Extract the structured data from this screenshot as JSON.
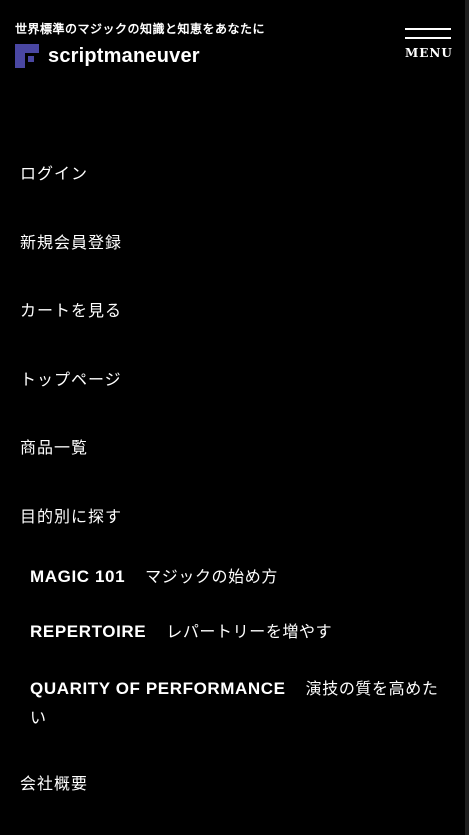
{
  "header": {
    "tagline": "世界標準のマジックの知識と知恵をあなたに",
    "logo_text": "scriptmaneuver",
    "logo_color": "#4a47a3",
    "menu_label": "MENU"
  },
  "nav": {
    "items": [
      {
        "label": "ログイン"
      },
      {
        "label": "新規会員登録"
      },
      {
        "label": "カートを見る"
      },
      {
        "label": "トップページ"
      },
      {
        "label": "商品一覧"
      },
      {
        "label": "目的別に探す"
      }
    ],
    "sub_items": [
      {
        "en": "MAGIC 101",
        "ja": "マジックの始め方"
      },
      {
        "en": "REPERTOIRE",
        "ja": "レパートリーを増やす"
      },
      {
        "en": "QUARITY OF PERFORMANCE",
        "ja": "演技の質を高めたい"
      }
    ],
    "company": {
      "label": "会社概要"
    }
  }
}
